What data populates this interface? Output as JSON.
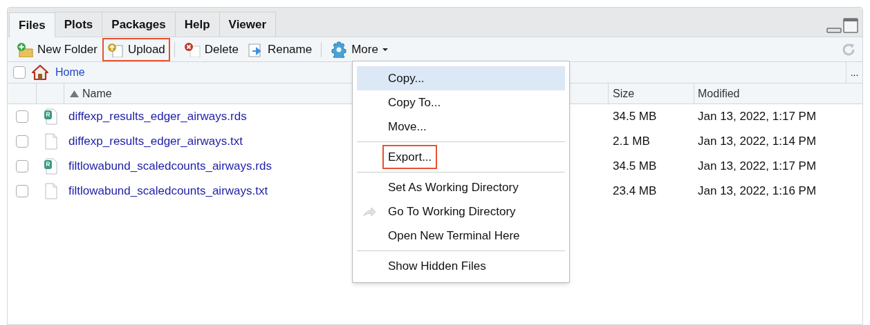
{
  "tabs": [
    {
      "label": "Files",
      "selected": true
    },
    {
      "label": "Plots",
      "selected": false
    },
    {
      "label": "Packages",
      "selected": false
    },
    {
      "label": "Help",
      "selected": false
    },
    {
      "label": "Viewer",
      "selected": false
    }
  ],
  "toolbar": [
    {
      "kind": "new-folder",
      "label": "New Folder",
      "highlighted": false
    },
    {
      "kind": "upload",
      "label": "Upload",
      "highlighted": true
    },
    {
      "kind": "delete",
      "label": "Delete",
      "highlighted": false
    },
    {
      "kind": "rename",
      "label": "Rename",
      "highlighted": false
    },
    {
      "kind": "more",
      "label": "More",
      "highlighted": false
    }
  ],
  "breadcrumb": {
    "checked": false,
    "path": "Home",
    "overflow": "..."
  },
  "table": {
    "columns": [
      "Name",
      "Size",
      "Modified"
    ],
    "rows": [
      {
        "kind": "rds",
        "checked": false,
        "name": "diffexp_results_edger_airways.rds",
        "size": "34.5 MB",
        "modified": "Jan 13, 2022, 1:17 PM"
      },
      {
        "kind": "txt",
        "checked": false,
        "name": "diffexp_results_edger_airways.txt",
        "size": "2.1 MB",
        "modified": "Jan 13, 2022, 1:14 PM"
      },
      {
        "kind": "rds",
        "checked": false,
        "name": "filtlowabund_scaledcounts_airways.rds",
        "size": "34.5 MB",
        "modified": "Jan 13, 2022, 1:17 PM"
      },
      {
        "kind": "txt",
        "checked": false,
        "name": "filtlowabund_scaledcounts_airways.txt",
        "size": "23.4 MB",
        "modified": "Jan 13, 2022, 1:16 PM"
      }
    ]
  },
  "more_menu": [
    {
      "kind": "item",
      "label": "Copy...",
      "selected": true,
      "highlighted": false
    },
    {
      "kind": "item",
      "label": "Copy To...",
      "selected": false,
      "highlighted": false
    },
    {
      "kind": "item",
      "label": "Move...",
      "selected": false,
      "highlighted": false
    },
    {
      "kind": "separator"
    },
    {
      "kind": "item",
      "label": "Export...",
      "selected": false,
      "highlighted": true
    },
    {
      "kind": "separator"
    },
    {
      "kind": "item",
      "label": "Set As Working Directory",
      "selected": false,
      "highlighted": false
    },
    {
      "kind": "goto",
      "label": "Go To Working Directory",
      "selected": false,
      "highlighted": false
    },
    {
      "kind": "item",
      "label": "Open New Terminal Here",
      "selected": false,
      "highlighted": false
    },
    {
      "kind": "separator"
    },
    {
      "kind": "item",
      "label": "Show Hidden Files",
      "selected": false,
      "highlighted": false
    }
  ]
}
